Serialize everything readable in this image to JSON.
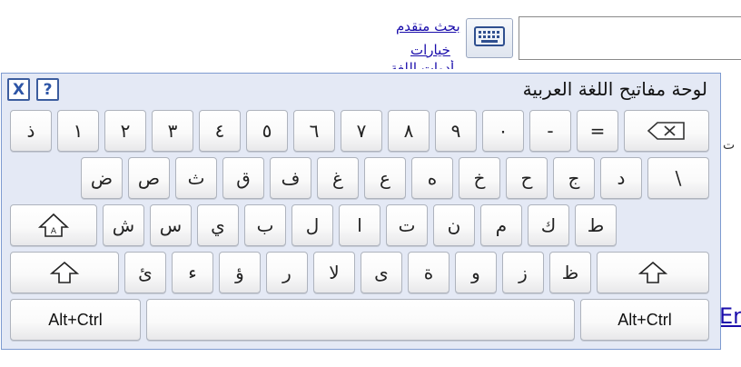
{
  "page": {
    "links": {
      "advanced_search": "بحث متقدم",
      "preferences": "خيارات",
      "language_tools": "أدوات اللغة"
    },
    "side_fragment": "ت",
    "side_english": "En"
  },
  "keyboard": {
    "title": "لوحة مفاتيح اللغة العربية",
    "close_label": "X",
    "help_label": "?",
    "row1": [
      "ذ",
      "١",
      "٢",
      "٣",
      "٤",
      "٥",
      "٦",
      "٧",
      "٨",
      "٩",
      "٠",
      "-",
      "="
    ],
    "row2": [
      "ض",
      "ص",
      "ث",
      "ق",
      "ف",
      "غ",
      "ع",
      "ه",
      "خ",
      "ح",
      "ج",
      "د",
      "\\"
    ],
    "row3": [
      "ش",
      "س",
      "ي",
      "ب",
      "ل",
      "ا",
      "ت",
      "ن",
      "م",
      "ك",
      "ط"
    ],
    "row4": [
      "ئ",
      "ء",
      "ؤ",
      "ر",
      "لا",
      "ى",
      "ة",
      "و",
      "ز",
      "ظ"
    ],
    "alt_ctrl_left": "Alt+Ctrl",
    "alt_ctrl_right": "Alt+Ctrl",
    "icons": {
      "backspace": "backspace-icon",
      "capslock": "caps-lock-icon",
      "shift": "shift-icon",
      "toggle": "keyboard-icon"
    }
  }
}
